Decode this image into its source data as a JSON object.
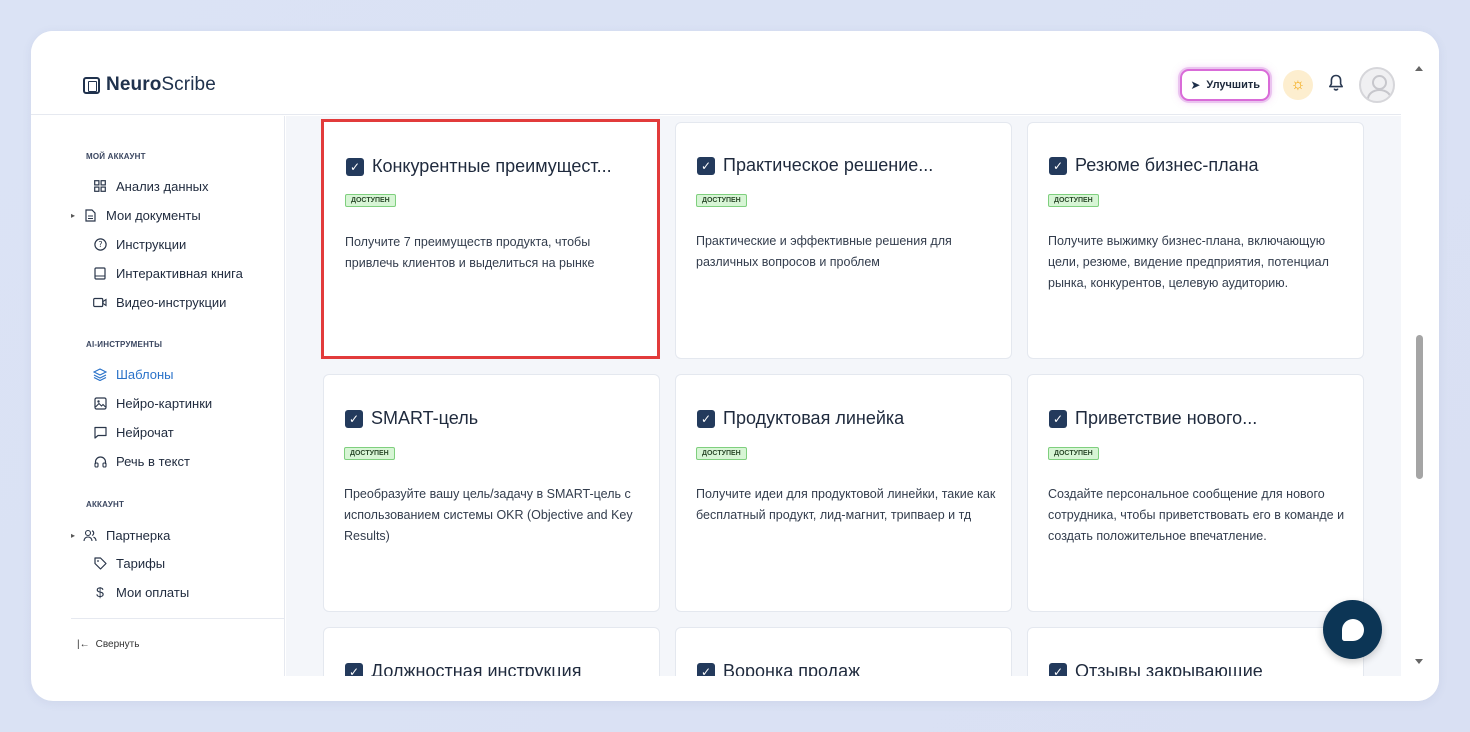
{
  "header": {
    "logo_bold": "Neuro",
    "logo_rest": "Scribe",
    "upgrade_label": "Улучшить"
  },
  "icons": {
    "logo": "logo-icon",
    "upgrade": "rocket-icon",
    "theme": "sun-icon",
    "notifications": "bell-icon",
    "profile": "avatar-icon",
    "chat": "chat-icon",
    "card_check": "checkbox-icon"
  },
  "sidebar": {
    "section_account": "Мой аккаунт",
    "section_ai": "AI-инструменты",
    "section_account2": "Аккаунт",
    "items_account": [
      {
        "label": "Анализ данных",
        "icon": "grid-icon"
      },
      {
        "label": "Мои документы",
        "icon": "document-icon"
      },
      {
        "label": "Инструкции",
        "icon": "help-icon"
      },
      {
        "label": "Интерактивная книга",
        "icon": "book-icon"
      },
      {
        "label": "Видео-инструкции",
        "icon": "video-icon"
      }
    ],
    "items_ai": [
      {
        "label": "Шаблоны",
        "icon": "layers-icon"
      },
      {
        "label": "Нейро-картинки",
        "icon": "image-icon"
      },
      {
        "label": "Нейрочат",
        "icon": "chat-bubble-icon"
      },
      {
        "label": "Речь в текст",
        "icon": "headphones-icon"
      }
    ],
    "items_account2": [
      {
        "label": "Партнерка",
        "icon": "users-icon"
      },
      {
        "label": "Тарифы",
        "icon": "tag-icon"
      },
      {
        "label": "Мои оплаты",
        "icon": "dollar-icon"
      }
    ],
    "collapse_label": "Свернуть"
  },
  "cards": [
    {
      "title": "Конкурентные преимущест...",
      "badge": "доступен",
      "desc": "Получите 7 преимуществ продукта, чтобы привлечь клиентов и выделиться на рынке"
    },
    {
      "title": "Практическое решение...",
      "badge": "доступен",
      "desc": "Практические и эффективные решения для различных вопросов и проблем"
    },
    {
      "title": "Резюме бизнес-плана",
      "badge": "доступен",
      "desc": "Получите выжимку бизнес-плана, включающую цели, резюме, видение предприятия, потенциал рынка, конкурентов, целевую аудиторию."
    },
    {
      "title": "SMART-цель",
      "badge": "доступен",
      "desc": "Преобразуйте вашу цель/задачу в SMART-цель с использованием системы OKR (Objective and Key Results)"
    },
    {
      "title": "Продуктовая линейка",
      "badge": "доступен",
      "desc": "Получите идеи для продуктовой линейки, такие как бесплатный продукт, лид-магнит, трипваер и тд"
    },
    {
      "title": "Приветствие нового...",
      "badge": "доступен",
      "desc": "Создайте персональное сообщение для нового сотрудника, чтобы приветствовать его в команде и создать положительное впечатление."
    },
    {
      "title": "Должностная инструкция",
      "badge": "",
      "desc": ""
    },
    {
      "title": "Воронка продаж",
      "badge": "",
      "desc": ""
    },
    {
      "title": "Отзывы закрывающие",
      "badge": "",
      "desc": ""
    }
  ]
}
